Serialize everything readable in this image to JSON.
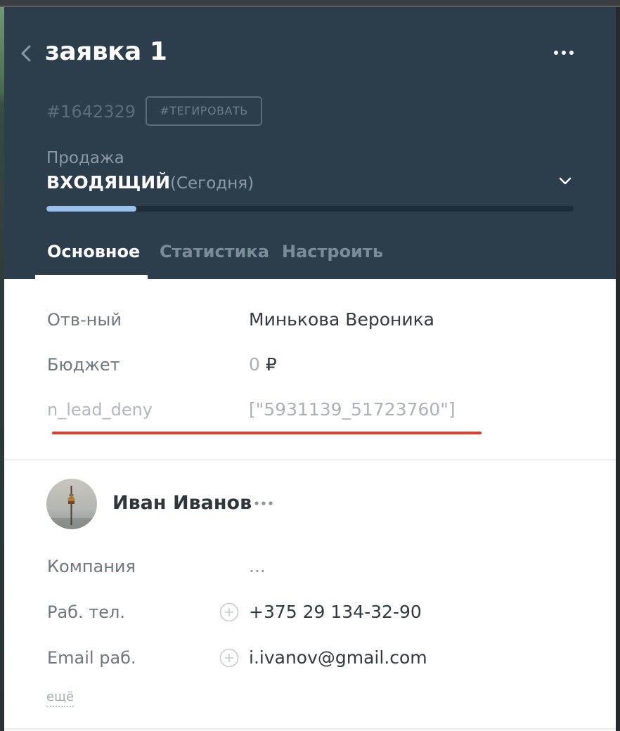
{
  "lead": {
    "title": "заявка 1",
    "id": "#1642329",
    "tag_button": "#ТЕГИРОВАТЬ",
    "pipeline": "Продажа",
    "status": "ВХОДЯЩИЙ",
    "status_date": "(Сегодня)",
    "progress": 0.17
  },
  "tabs": [
    {
      "label": "Основное",
      "active": true
    },
    {
      "label": "Статистика",
      "active": false
    },
    {
      "label": "Настроить",
      "active": false
    }
  ],
  "fields": {
    "responsible": {
      "label": "Отв-ный",
      "value": "Минькова Вероника"
    },
    "budget": {
      "label": "Бюджет",
      "value": "0",
      "currency": "₽"
    },
    "custom": {
      "label": "n_lead_deny",
      "value": "[\"5931139_51723760\"]"
    }
  },
  "contact": {
    "name": "Иван Иванов",
    "fields": [
      {
        "label": "Компания",
        "value": "..."
      },
      {
        "label": "Раб. тел.",
        "value": "+375 29 134-32-90"
      },
      {
        "label": "Email раб.",
        "value": "i.ivanov@gmail.com"
      }
    ],
    "more_link": "ещё"
  },
  "icons": {
    "back": "chevron-left-icon",
    "menu": "more-horizontal-icon",
    "status_dropdown": "chevron-down-icon",
    "add": "plus-circle-icon"
  },
  "colors": {
    "header_bg": "#2c3e4c",
    "progress_fill": "#98c2ee",
    "highlight_underline": "#e23d2b"
  }
}
